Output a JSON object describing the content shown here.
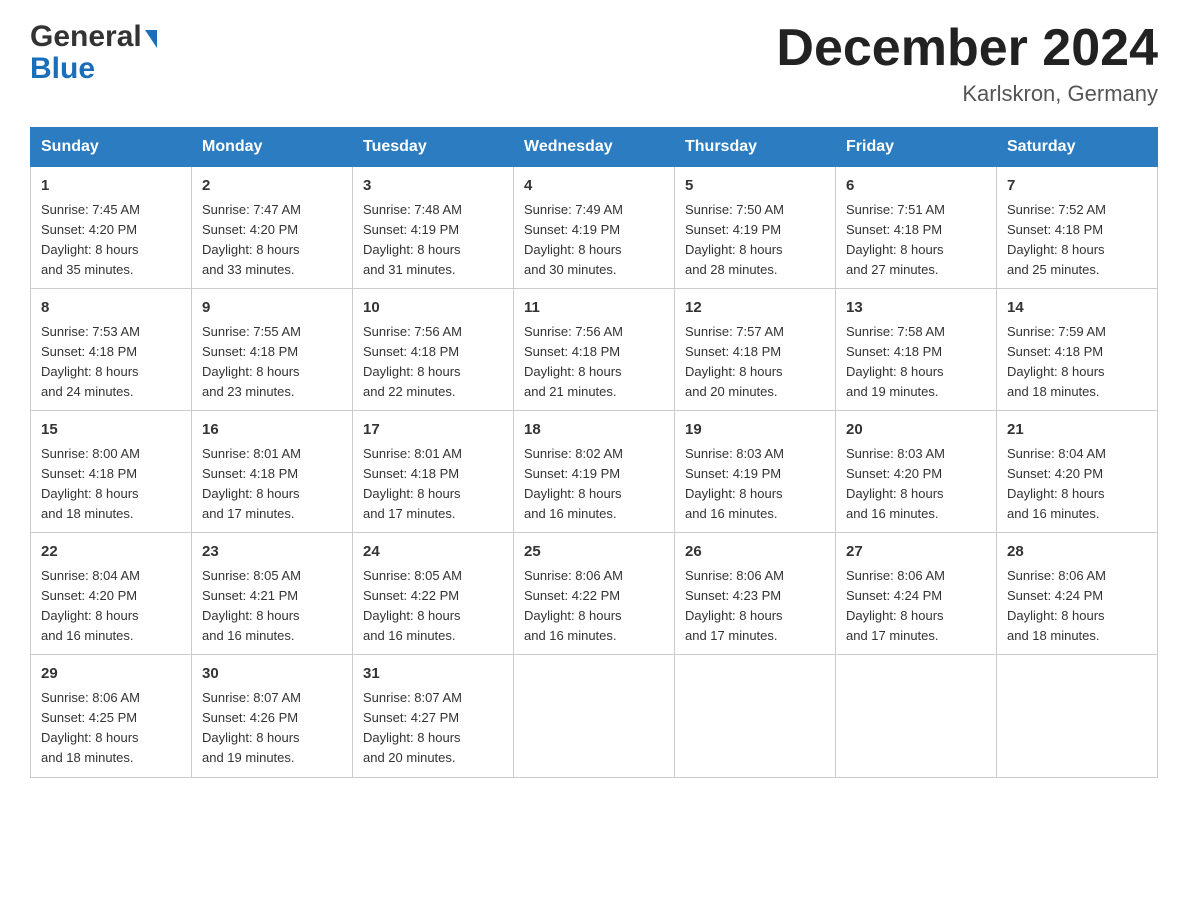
{
  "header": {
    "logo_general": "General",
    "logo_blue": "Blue",
    "month_title": "December 2024",
    "location": "Karlskron, Germany"
  },
  "weekdays": [
    "Sunday",
    "Monday",
    "Tuesday",
    "Wednesday",
    "Thursday",
    "Friday",
    "Saturday"
  ],
  "weeks": [
    [
      {
        "day": "1",
        "sunrise": "7:45 AM",
        "sunset": "4:20 PM",
        "daylight": "8 hours and 35 minutes."
      },
      {
        "day": "2",
        "sunrise": "7:47 AM",
        "sunset": "4:20 PM",
        "daylight": "8 hours and 33 minutes."
      },
      {
        "day": "3",
        "sunrise": "7:48 AM",
        "sunset": "4:19 PM",
        "daylight": "8 hours and 31 minutes."
      },
      {
        "day": "4",
        "sunrise": "7:49 AM",
        "sunset": "4:19 PM",
        "daylight": "8 hours and 30 minutes."
      },
      {
        "day": "5",
        "sunrise": "7:50 AM",
        "sunset": "4:19 PM",
        "daylight": "8 hours and 28 minutes."
      },
      {
        "day": "6",
        "sunrise": "7:51 AM",
        "sunset": "4:18 PM",
        "daylight": "8 hours and 27 minutes."
      },
      {
        "day": "7",
        "sunrise": "7:52 AM",
        "sunset": "4:18 PM",
        "daylight": "8 hours and 25 minutes."
      }
    ],
    [
      {
        "day": "8",
        "sunrise": "7:53 AM",
        "sunset": "4:18 PM",
        "daylight": "8 hours and 24 minutes."
      },
      {
        "day": "9",
        "sunrise": "7:55 AM",
        "sunset": "4:18 PM",
        "daylight": "8 hours and 23 minutes."
      },
      {
        "day": "10",
        "sunrise": "7:56 AM",
        "sunset": "4:18 PM",
        "daylight": "8 hours and 22 minutes."
      },
      {
        "day": "11",
        "sunrise": "7:56 AM",
        "sunset": "4:18 PM",
        "daylight": "8 hours and 21 minutes."
      },
      {
        "day": "12",
        "sunrise": "7:57 AM",
        "sunset": "4:18 PM",
        "daylight": "8 hours and 20 minutes."
      },
      {
        "day": "13",
        "sunrise": "7:58 AM",
        "sunset": "4:18 PM",
        "daylight": "8 hours and 19 minutes."
      },
      {
        "day": "14",
        "sunrise": "7:59 AM",
        "sunset": "4:18 PM",
        "daylight": "8 hours and 18 minutes."
      }
    ],
    [
      {
        "day": "15",
        "sunrise": "8:00 AM",
        "sunset": "4:18 PM",
        "daylight": "8 hours and 18 minutes."
      },
      {
        "day": "16",
        "sunrise": "8:01 AM",
        "sunset": "4:18 PM",
        "daylight": "8 hours and 17 minutes."
      },
      {
        "day": "17",
        "sunrise": "8:01 AM",
        "sunset": "4:18 PM",
        "daylight": "8 hours and 17 minutes."
      },
      {
        "day": "18",
        "sunrise": "8:02 AM",
        "sunset": "4:19 PM",
        "daylight": "8 hours and 16 minutes."
      },
      {
        "day": "19",
        "sunrise": "8:03 AM",
        "sunset": "4:19 PM",
        "daylight": "8 hours and 16 minutes."
      },
      {
        "day": "20",
        "sunrise": "8:03 AM",
        "sunset": "4:20 PM",
        "daylight": "8 hours and 16 minutes."
      },
      {
        "day": "21",
        "sunrise": "8:04 AM",
        "sunset": "4:20 PM",
        "daylight": "8 hours and 16 minutes."
      }
    ],
    [
      {
        "day": "22",
        "sunrise": "8:04 AM",
        "sunset": "4:20 PM",
        "daylight": "8 hours and 16 minutes."
      },
      {
        "day": "23",
        "sunrise": "8:05 AM",
        "sunset": "4:21 PM",
        "daylight": "8 hours and 16 minutes."
      },
      {
        "day": "24",
        "sunrise": "8:05 AM",
        "sunset": "4:22 PM",
        "daylight": "8 hours and 16 minutes."
      },
      {
        "day": "25",
        "sunrise": "8:06 AM",
        "sunset": "4:22 PM",
        "daylight": "8 hours and 16 minutes."
      },
      {
        "day": "26",
        "sunrise": "8:06 AM",
        "sunset": "4:23 PM",
        "daylight": "8 hours and 17 minutes."
      },
      {
        "day": "27",
        "sunrise": "8:06 AM",
        "sunset": "4:24 PM",
        "daylight": "8 hours and 17 minutes."
      },
      {
        "day": "28",
        "sunrise": "8:06 AM",
        "sunset": "4:24 PM",
        "daylight": "8 hours and 18 minutes."
      }
    ],
    [
      {
        "day": "29",
        "sunrise": "8:06 AM",
        "sunset": "4:25 PM",
        "daylight": "8 hours and 18 minutes."
      },
      {
        "day": "30",
        "sunrise": "8:07 AM",
        "sunset": "4:26 PM",
        "daylight": "8 hours and 19 minutes."
      },
      {
        "day": "31",
        "sunrise": "8:07 AM",
        "sunset": "4:27 PM",
        "daylight": "8 hours and 20 minutes."
      },
      null,
      null,
      null,
      null
    ]
  ],
  "labels": {
    "sunrise": "Sunrise:",
    "sunset": "Sunset:",
    "daylight": "Daylight:"
  }
}
